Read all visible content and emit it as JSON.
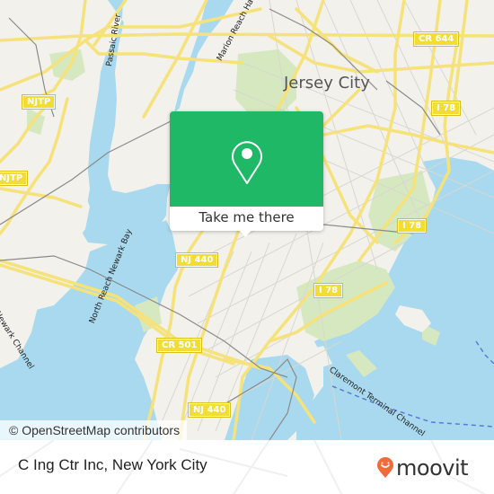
{
  "map": {
    "city_label": "Jersey City",
    "road_shields": [
      {
        "id": "njtp-1",
        "label": "NJTP"
      },
      {
        "id": "njtp-2",
        "label": "NJTP"
      },
      {
        "id": "cr644",
        "label": "CR 644"
      },
      {
        "id": "i78-1",
        "label": "I 78"
      },
      {
        "id": "i78-2",
        "label": "I 78"
      },
      {
        "id": "i78-3",
        "label": "I 78"
      },
      {
        "id": "nj440-1",
        "label": "NJ 440"
      },
      {
        "id": "nj440-2",
        "label": "NJ 440"
      },
      {
        "id": "cr501",
        "label": "CR 501"
      }
    ],
    "water_labels": [
      {
        "id": "passaic-river",
        "label": "Passaic River"
      },
      {
        "id": "hackensack-river",
        "label": "Marion Reach Hackensack River"
      },
      {
        "id": "newark-bay",
        "label": "North Reach Newark Bay"
      },
      {
        "id": "newark-channel",
        "label": "Newark Channel"
      },
      {
        "id": "claremont-channel",
        "label": "Claremont Terminal Channel"
      }
    ],
    "colors": {
      "land": "#f2f1ec",
      "water": "#a8d9ee",
      "park": "#d5e8c0",
      "road_major": "#f6e27a",
      "road_minor": "#d9d7d0",
      "rail": "#8a8a8a"
    }
  },
  "popup": {
    "icon": "map-pin-icon",
    "button_label": "Take me there",
    "color": "#1fb866"
  },
  "attribution": "© OpenStreetMap contributors",
  "footer": {
    "place_name": "C Ing Ctr Inc, New York City",
    "logo_text": "moovit",
    "logo_color": "#f26b3a"
  }
}
